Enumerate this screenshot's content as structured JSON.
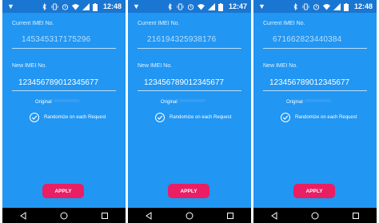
{
  "phones": [
    {
      "status": {
        "time": "12:48"
      },
      "current_imei_label": "Current IMEI No.",
      "current_imei_value": "145345317175296",
      "new_imei_label": "New IMEI No.",
      "new_imei_value": "123456789012345677",
      "original_label": "Original",
      "original_value": "**************",
      "randomize_label": "Randomize on each Request",
      "randomize_checked": true,
      "apply_label": "APPLY"
    },
    {
      "status": {
        "time": "12:47"
      },
      "current_imei_label": "Current IMEI No.",
      "current_imei_value": "216194325938176",
      "new_imei_label": "New IMEI No.",
      "new_imei_value": "123456789012345677",
      "original_label": "Original",
      "original_value": "**************",
      "randomize_label": "Randomize on each Request",
      "randomize_checked": true,
      "apply_label": "APPLY"
    },
    {
      "status": {
        "time": "12:48"
      },
      "current_imei_label": "Current IMEI No.",
      "current_imei_value": "671662823440384",
      "new_imei_label": "New IMEI No.",
      "new_imei_value": "123456789012345677",
      "original_label": "Original",
      "original_value": "**************",
      "randomize_label": "Randomize on each Request",
      "randomize_checked": true,
      "apply_label": "APPLY"
    }
  ],
  "icons": {
    "status_left": "notification-icon",
    "status_right": [
      "bluetooth-icon",
      "vibrate-icon",
      "alarm-icon",
      "wifi-icon",
      "signal-icon",
      "battery-icon"
    ],
    "nav": [
      "back-icon",
      "home-icon",
      "recents-icon"
    ]
  },
  "colors": {
    "background": "#2196f3",
    "status_bar": "#1976d2",
    "accent": "#e91e63",
    "nav_bar": "#000000"
  }
}
